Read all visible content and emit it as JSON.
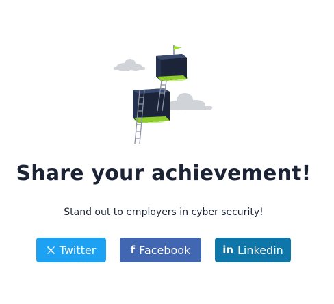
{
  "share": {
    "headline": "Share your achievement!",
    "subline": "Stand out to employers in cyber security!"
  },
  "buttons": [
    {
      "label": "Twitter",
      "icon": "x-icon",
      "color": "#1da1f2"
    },
    {
      "label": "Facebook",
      "icon": "facebook-icon",
      "color": "#4267b2"
    },
    {
      "label": "Linkedin",
      "icon": "linkedin-icon",
      "color": "#0e76a8"
    }
  ],
  "colors": {
    "text": "#1b2335",
    "cube": "#1f2a44",
    "glow": "#9be02a",
    "cloud": "#d0d3d8"
  }
}
